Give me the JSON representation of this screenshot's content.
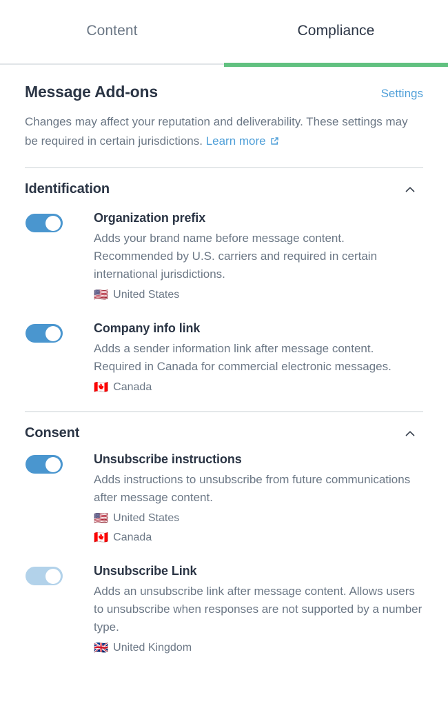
{
  "tabs": [
    {
      "label": "Content",
      "active": false
    },
    {
      "label": "Compliance",
      "active": true
    }
  ],
  "panel": {
    "title": "Message Add-ons",
    "settings_label": "Settings",
    "description_text": "Changes may affect your reputation and deliverability. These settings may be required in certain jurisdictions. ",
    "description_link": "Learn more",
    "external_link_icon": "external-link-icon"
  },
  "colors": {
    "accent_green": "#61c180",
    "link_blue": "#4f9fd8",
    "toggle_on": "#4a96cf",
    "heading": "#2b3545",
    "body_text": "#6b7785",
    "divider": "#e4e8ea"
  },
  "sections": [
    {
      "title": "Identification",
      "chevron": "chevron-up-icon",
      "expanded": true,
      "items": [
        {
          "title": "Organization prefix",
          "description": "Adds your brand name before message content. Recommended by U.S. carriers and required in certain international jurisdictions.",
          "toggle_state": "on",
          "toggle_enabled": true,
          "jurisdictions": [
            {
              "flag": "🇺🇸",
              "flag_name": "flag-united-states-icon",
              "label": "United States"
            }
          ]
        },
        {
          "title": "Company info link",
          "description": "Adds a sender information link after message content. Required in Canada for commercial electronic messages.",
          "toggle_state": "on",
          "toggle_enabled": true,
          "jurisdictions": [
            {
              "flag": "🇨🇦",
              "flag_name": "flag-canada-icon",
              "label": "Canada"
            }
          ]
        }
      ]
    },
    {
      "title": "Consent",
      "chevron": "chevron-up-icon",
      "expanded": true,
      "items": [
        {
          "title": "Unsubscribe instructions",
          "description": "Adds instructions to unsubscribe from future communications after message content.",
          "toggle_state": "on",
          "toggle_enabled": true,
          "jurisdictions": [
            {
              "flag": "🇺🇸",
              "flag_name": "flag-united-states-icon",
              "label": "United States"
            },
            {
              "flag": "🇨🇦",
              "flag_name": "flag-canada-icon",
              "label": "Canada"
            }
          ]
        },
        {
          "title": "Unsubscribe Link",
          "description": "Adds an unsubscribe link after message content. Allows users to unsubscribe when responses are not supported by a number type.",
          "toggle_state": "on",
          "toggle_enabled": false,
          "jurisdictions": [
            {
              "flag": "🇬🇧",
              "flag_name": "flag-united-kingdom-icon",
              "label": "United Kingdom"
            }
          ]
        }
      ]
    }
  ]
}
